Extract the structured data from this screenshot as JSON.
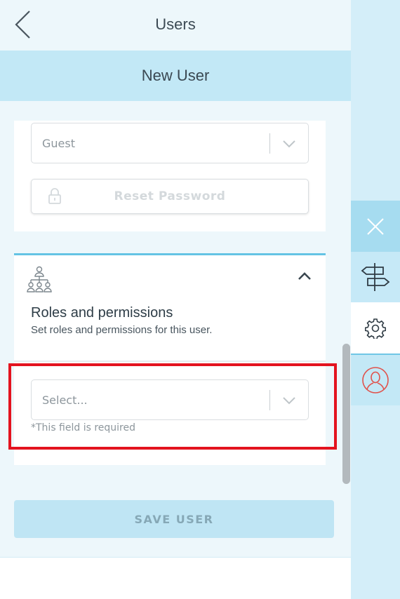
{
  "header": {
    "title": "Users",
    "back_icon": "chevron-left-icon"
  },
  "subheader": {
    "title": "New User"
  },
  "account_card": {
    "role_select": {
      "value": "Guest"
    },
    "reset_password": {
      "label": "Reset Password",
      "icon": "lock-icon",
      "disabled": true
    }
  },
  "roles_card": {
    "icon": "org-chart-icon",
    "title": "Roles and permissions",
    "subtitle": "Set roles and permissions for this user.",
    "select": {
      "placeholder": "Select..."
    },
    "required_text": "*This field is required",
    "expanded": true
  },
  "save_button": {
    "label": "SAVE USER",
    "disabled": true
  },
  "side_rail": {
    "items": [
      {
        "name": "close",
        "icon": "close-icon"
      },
      {
        "name": "signpost",
        "icon": "signpost-icon"
      },
      {
        "name": "settings",
        "icon": "gear-icon",
        "active": true
      },
      {
        "name": "user",
        "icon": "user-avatar-icon"
      }
    ]
  },
  "colors": {
    "accent": "#64c3e4",
    "subheader_bg": "#c2e8f6",
    "highlight": "#e3131f",
    "avatar_icon": "#e0524c"
  }
}
